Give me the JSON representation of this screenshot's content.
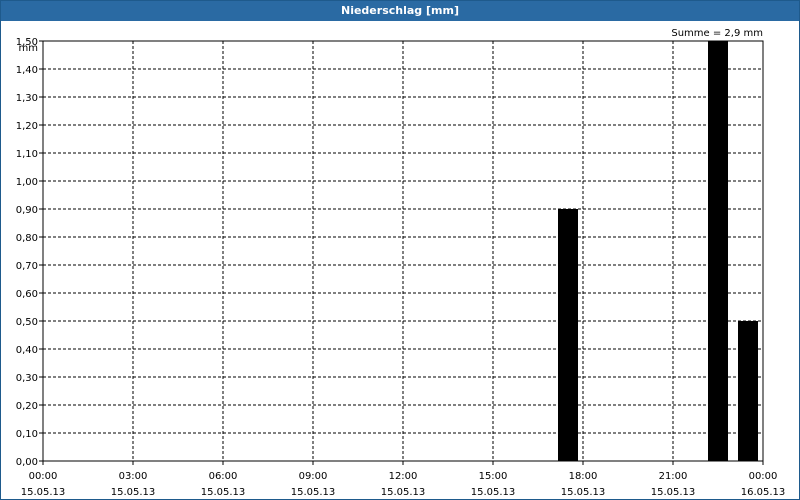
{
  "window": {
    "title": "Niederschlag [mm]"
  },
  "chart_data": {
    "type": "bar",
    "ylabel": "mm",
    "annotation": "Summe = 2,9 mm",
    "ylim": [
      0,
      1.5
    ],
    "yticks": [
      "0,00",
      "0,10",
      "0,20",
      "0,30",
      "0,40",
      "0,50",
      "0,60",
      "0,70",
      "0,80",
      "0,90",
      "1,00",
      "1,10",
      "1,20",
      "1,30",
      "1,40",
      "1,50"
    ],
    "xlim_hours": [
      0,
      24
    ],
    "xticks": [
      {
        "time": "00:00",
        "date": "15.05.13"
      },
      {
        "time": "03:00",
        "date": "15.05.13"
      },
      {
        "time": "06:00",
        "date": "15.05.13"
      },
      {
        "time": "09:00",
        "date": "15.05.13"
      },
      {
        "time": "12:00",
        "date": "15.05.13"
      },
      {
        "time": "15:00",
        "date": "15.05.13"
      },
      {
        "time": "18:00",
        "date": "15.05.13"
      },
      {
        "time": "21:00",
        "date": "15.05.13"
      },
      {
        "time": "00:00",
        "date": "16.05.13"
      }
    ],
    "bars": [
      {
        "time": "17:30",
        "value": 0.9
      },
      {
        "time": "22:30",
        "value": 1.5
      },
      {
        "time": "23:30",
        "value": 0.5
      }
    ],
    "bar_color": "#000000",
    "grid": true
  }
}
